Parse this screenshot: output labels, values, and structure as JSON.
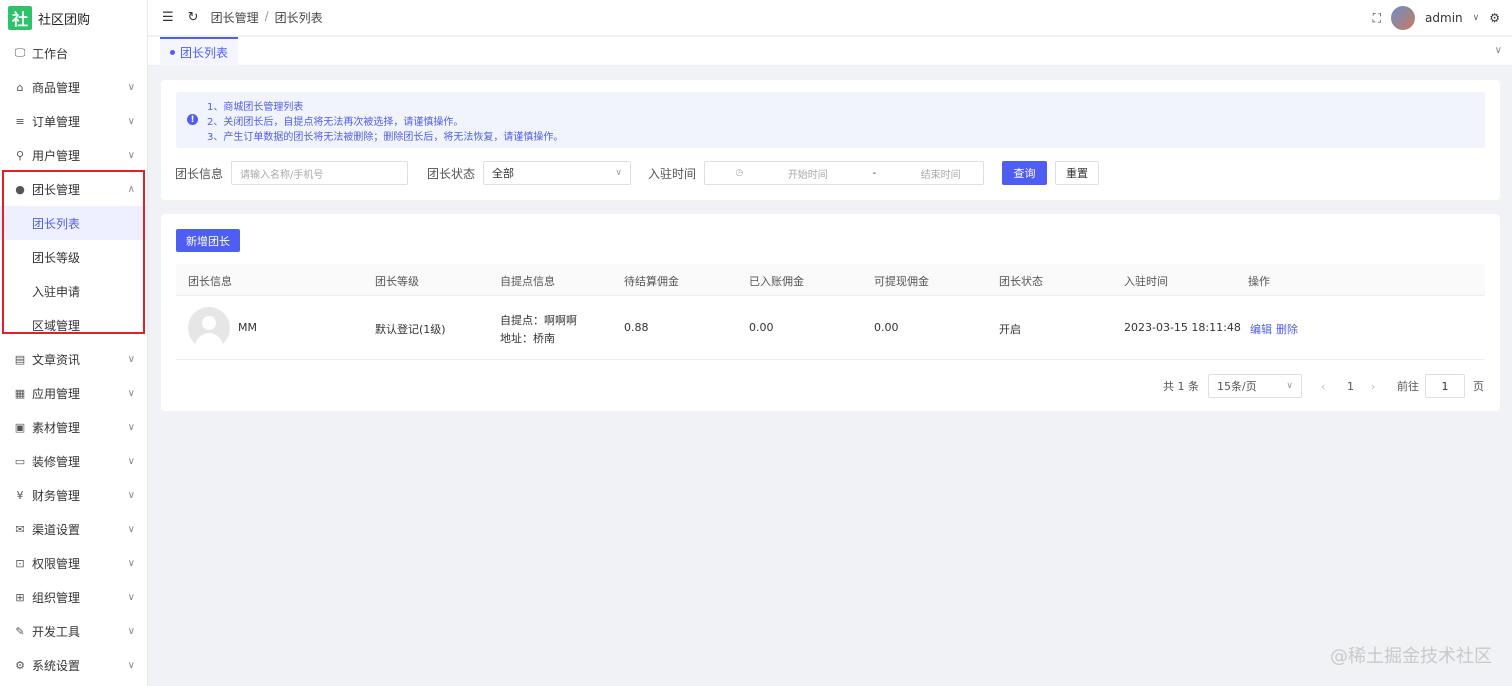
{
  "app": {
    "logo_char": "社",
    "title": "社区团购"
  },
  "sidebar": {
    "items": [
      {
        "label": "工作台",
        "icon": "monitor-icon",
        "glyph": "🖵",
        "expandable": false
      },
      {
        "label": "商品管理",
        "icon": "shop-icon",
        "glyph": "⌂",
        "expandable": true
      },
      {
        "label": "订单管理",
        "icon": "list-icon",
        "glyph": "≡",
        "expandable": true
      },
      {
        "label": "用户管理",
        "icon": "user-icon",
        "glyph": "⚲",
        "expandable": true
      },
      {
        "label": "团长管理",
        "icon": "leader-icon",
        "glyph": "●",
        "expandable": true,
        "expanded": true
      },
      {
        "label": "文章资讯",
        "icon": "article-icon",
        "glyph": "▤",
        "expandable": true
      },
      {
        "label": "应用管理",
        "icon": "apps-icon",
        "glyph": "▦",
        "expandable": true
      },
      {
        "label": "素材管理",
        "icon": "image-icon",
        "glyph": "▣",
        "expandable": true
      },
      {
        "label": "装修管理",
        "icon": "decorate-icon",
        "glyph": "▭",
        "expandable": true
      },
      {
        "label": "财务管理",
        "icon": "yen-icon",
        "glyph": "¥",
        "expandable": true
      },
      {
        "label": "渠道设置",
        "icon": "mail-icon",
        "glyph": "✉",
        "expandable": true
      },
      {
        "label": "权限管理",
        "icon": "lock-icon",
        "glyph": "⊡",
        "expandable": true
      },
      {
        "label": "组织管理",
        "icon": "org-icon",
        "glyph": "⊞",
        "expandable": true
      },
      {
        "label": "开发工具",
        "icon": "pen-icon",
        "glyph": "✎",
        "expandable": true
      },
      {
        "label": "系统设置",
        "icon": "gear-icon",
        "glyph": "⚙",
        "expandable": true
      }
    ],
    "sub_items": [
      {
        "label": "团长列表",
        "active": true
      },
      {
        "label": "团长等级",
        "active": false
      },
      {
        "label": "入驻申请",
        "active": false
      },
      {
        "label": "区域管理",
        "active": false
      }
    ]
  },
  "topbar": {
    "breadcrumb": [
      "团长管理",
      "团长列表"
    ],
    "username": "admin"
  },
  "tabs": [
    {
      "label": "团长列表"
    }
  ],
  "notice": {
    "lines": [
      "1、商城团长管理列表",
      "2、关闭团长后，自提点将无法再次被选择，请谨慎操作。",
      "3、产生订单数据的团长将无法被删除；删除团长后，将无法恢复，请谨慎操作。"
    ]
  },
  "filters": {
    "info_label": "团长信息",
    "info_placeholder": "请输入名称/手机号",
    "status_label": "团长状态",
    "status_value": "全部",
    "time_label": "入驻时间",
    "start_placeholder": "开始时间",
    "range_sep": "-",
    "end_placeholder": "结束时间",
    "query_btn": "查询",
    "reset_btn": "重置"
  },
  "table": {
    "add_btn": "新增团长",
    "columns": [
      "团长信息",
      "团长等级",
      "自提点信息",
      "待结算佣金",
      "已入账佣金",
      "可提现佣金",
      "团长状态",
      "入驻时间",
      "操作"
    ],
    "rows": [
      {
        "name": "MM",
        "level": "默认登记(1级)",
        "pickup_name": "自提点：啊啊啊",
        "pickup_addr": "地址：桥南",
        "pending": "0.88",
        "credited": "0.00",
        "withdrawable": "0.00",
        "status": "开启",
        "joined": "2023-03-15 18:11:48",
        "edit": "编辑",
        "delete": "删除"
      }
    ]
  },
  "pagination": {
    "total": "共 1 条",
    "page_size": "15条/页",
    "current": "1",
    "goto_label": "前往",
    "goto_value": "1",
    "page_unit": "页"
  },
  "watermark": "@稀土掘金技术社区",
  "colors": {
    "primary": "#4e5ef2",
    "logo": "#2ec26a",
    "highlight": "#e0202a"
  }
}
